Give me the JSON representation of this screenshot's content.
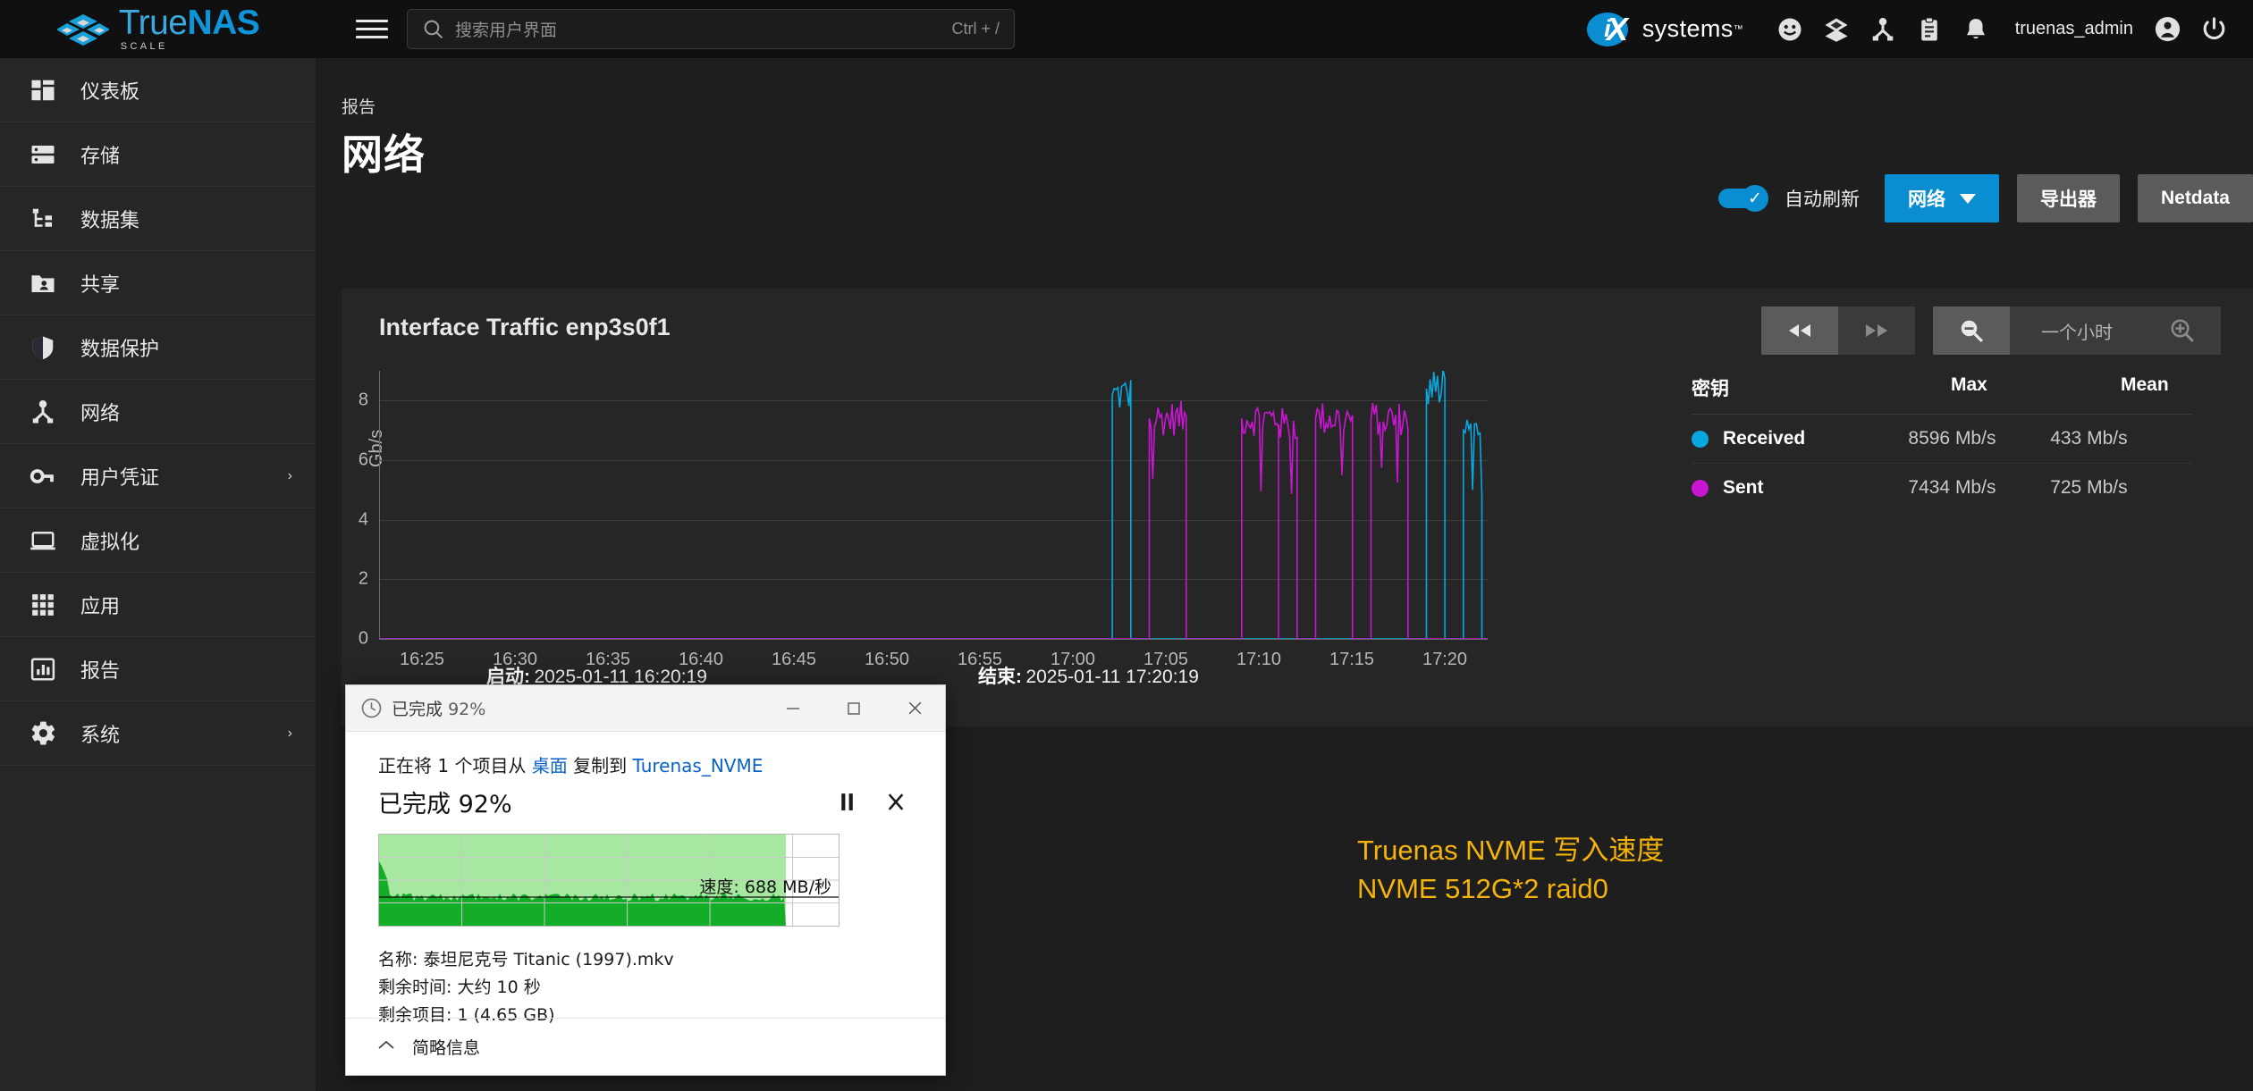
{
  "header": {
    "logo": {
      "primary": "True",
      "secondary": "NAS",
      "sub": "SCALE"
    },
    "menu_icon": "hamburger-icon",
    "search": {
      "placeholder": "搜索用户界面",
      "shortcut": "Ctrl + /"
    },
    "brand": {
      "name": "systems",
      "mark": "iX",
      "tm": "™"
    },
    "icons": [
      "smiley-icon",
      "layers-icon",
      "network-icon",
      "clipboard-icon",
      "bell-icon"
    ],
    "username": "truenas_admin",
    "account_icon": "user-circle-icon",
    "power_icon": "power-icon"
  },
  "sidebar": {
    "items": [
      {
        "label": "仪表板",
        "icon": "dashboard-icon",
        "expandable": false
      },
      {
        "label": "存储",
        "icon": "storage-icon",
        "expandable": false
      },
      {
        "label": "数据集",
        "icon": "datasets-icon",
        "expandable": false
      },
      {
        "label": "共享",
        "icon": "shares-folder-icon",
        "expandable": false
      },
      {
        "label": "数据保护",
        "icon": "shield-icon",
        "expandable": false
      },
      {
        "label": "网络",
        "icon": "network-icon",
        "expandable": false
      },
      {
        "label": "用户凭证",
        "icon": "key-icon",
        "expandable": true
      },
      {
        "label": "虚拟化",
        "icon": "laptop-icon",
        "expandable": false
      },
      {
        "label": "应用",
        "icon": "apps-grid-icon",
        "expandable": false
      },
      {
        "label": "报告",
        "icon": "chart-bars-icon",
        "expandable": false
      },
      {
        "label": "系统",
        "icon": "gear-icon",
        "expandable": true
      }
    ],
    "expand_arrow": "›"
  },
  "page": {
    "breadcrumb": "报告",
    "title": "网络",
    "toolbar": {
      "autorefresh_label": "自动刷新",
      "autorefresh_on": true,
      "category_button": "网络",
      "exporters_button": "导出器",
      "netdata_button": "Netdata"
    }
  },
  "chart_card": {
    "title": "Interface Traffic enp3s0f1",
    "controls": {
      "rewind": "rewind-icon",
      "forward": "forward-icon",
      "zoom_out": "zoom-out-icon",
      "range_label": "一个小时",
      "zoom_in": "zoom-in-icon"
    },
    "start_label": "启动:",
    "start_value": "2025-01-11 16:20:19",
    "end_label": "结束:",
    "end_value": "2025-01-11 17:20:19",
    "legend": {
      "headers": [
        "密钥",
        "Max",
        "Mean"
      ],
      "rows": [
        {
          "name": "Received",
          "color": "#09a7e0",
          "max": "8596 Mb/s",
          "mean": "433 Mb/s"
        },
        {
          "name": "Sent",
          "color": "#c916d2",
          "max": "7434 Mb/s",
          "mean": "725 Mb/s"
        }
      ]
    }
  },
  "chart_data": {
    "type": "line",
    "title": "Interface Traffic enp3s0f1",
    "xlabel": "",
    "ylabel": "Gb/s",
    "ylim": [
      0,
      9
    ],
    "yticks": [
      0,
      2,
      4,
      6,
      8
    ],
    "xticks": [
      "16:25",
      "16:30",
      "16:35",
      "16:40",
      "16:45",
      "16:50",
      "16:55",
      "17:00",
      "17:05",
      "17:10",
      "17:15",
      "17:20"
    ],
    "x_range": [
      "16:20:19",
      "17:20:19"
    ],
    "grid": true,
    "legend_position": "right",
    "series": [
      {
        "name": "Received",
        "color": "#09a7e0",
        "unit": "Gb/s",
        "max": 8.596,
        "mean": 0.433,
        "bursts": [
          {
            "start": "17:00",
            "end": "17:01",
            "level": 8.2
          },
          {
            "start": "17:17",
            "end": "17:18",
            "level": 8.4
          },
          {
            "start": "17:19",
            "end": "17:20",
            "level": 7.0
          }
        ]
      },
      {
        "name": "Sent",
        "color": "#c916d2",
        "unit": "Gb/s",
        "max": 7.434,
        "mean": 0.725,
        "bursts": [
          {
            "start": "17:02",
            "end": "17:04",
            "level": 7.4
          },
          {
            "start": "17:07",
            "end": "17:09",
            "level": 7.4
          },
          {
            "start": "17:09",
            "end": "17:10",
            "level": 7.2
          },
          {
            "start": "17:11",
            "end": "17:13",
            "level": 7.4
          },
          {
            "start": "17:14",
            "end": "17:16",
            "level": 7.4
          }
        ]
      }
    ]
  },
  "copy_dialog": {
    "titlebar": {
      "prefix": "已完成",
      "percent": "92%",
      "icon": "clock-icon"
    },
    "window_buttons": {
      "minimize": "minimize-icon",
      "maximize": "maximize-icon",
      "close": "close-icon"
    },
    "copy_text_prefix": "正在将 1 个项目从",
    "source": "桌面",
    "copy_text_mid": "复制到",
    "destination": "Turenas_NVME",
    "progress_text": "已完成 92%",
    "pause_icon": "pause-icon",
    "cancel_icon": "cancel-icon",
    "speed_label": "速度: 688 MB/秒",
    "details": [
      "名称: 泰坦尼克号 Titanic (1997).mkv",
      "剩余时间: 大约 10 秒",
      "剩余项目: 1 (4.65 GB)"
    ],
    "footer_label": "简略信息",
    "footer_chevron": "chevron-up-icon"
  },
  "annotation": {
    "line1": "Truenas NVME 写入速度",
    "line2": "NVME 512G*2 raid0",
    "color": "#f5b30b"
  }
}
